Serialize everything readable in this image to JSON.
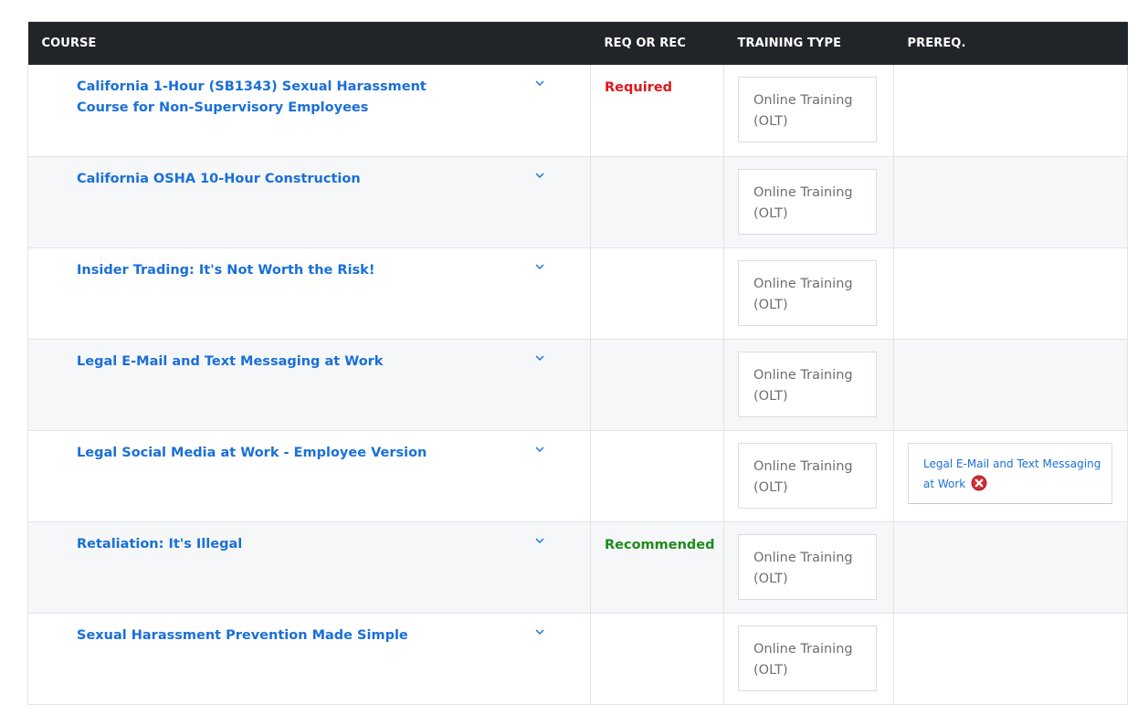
{
  "header": {
    "course": "COURSE",
    "req": "REQ OR REC",
    "type": "TRAINING TYPE",
    "prereq": "PREREQ."
  },
  "colors": {
    "link": "#1a6fd8",
    "required": "#e0161b",
    "recommended": "#1e8a1e",
    "header_bg": "#212529"
  },
  "rows": [
    {
      "course": "California 1-Hour (SB1343) Sexual Harassment Course for Non-Supervisory Employees",
      "req": "Required",
      "type": "Online Training (OLT)",
      "prereq": ""
    },
    {
      "course": "California OSHA 10-Hour Construction",
      "req": "",
      "type": "Online Training (OLT)",
      "prereq": ""
    },
    {
      "course": "Insider Trading: It's Not Worth the Risk!",
      "req": "",
      "type": "Online Training (OLT)",
      "prereq": ""
    },
    {
      "course": "Legal E-Mail and Text Messaging at Work",
      "req": "",
      "type": "Online Training (OLT)",
      "prereq": ""
    },
    {
      "course": "Legal Social Media at Work - Employee Version",
      "req": "",
      "type": "Online Training (OLT)",
      "prereq": "Legal E-Mail and Text Messaging at Work"
    },
    {
      "course": "Retaliation: It's Illegal",
      "req": "Recommended",
      "type": "Online Training (OLT)",
      "prereq": ""
    },
    {
      "course": "Sexual Harassment Prevention Made Simple",
      "req": "",
      "type": "Online Training (OLT)",
      "prereq": ""
    }
  ],
  "icons": {
    "expand": "chevron-down-icon",
    "remove": "remove-prereq-icon"
  }
}
